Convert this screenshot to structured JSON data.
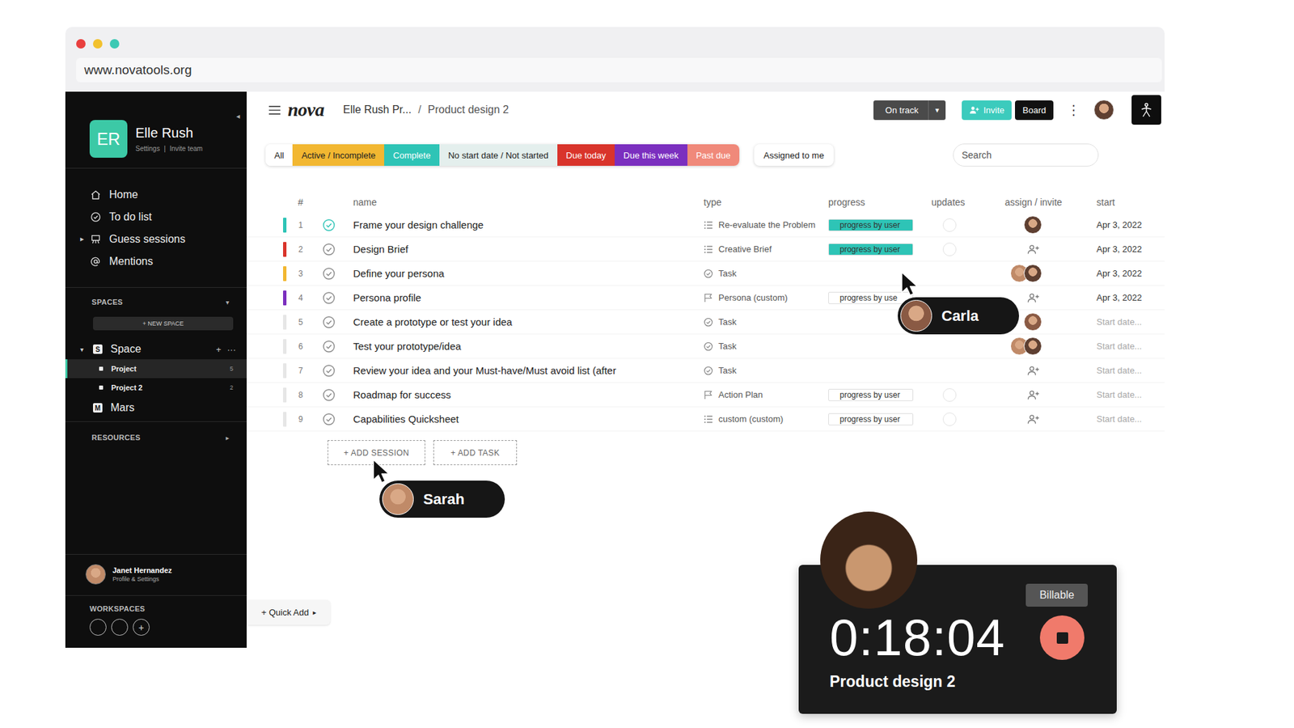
{
  "browser": {
    "url": "www.novatools.org"
  },
  "sidebar": {
    "collapse": "◂",
    "user": {
      "initials": "ER",
      "name": "Elle Rush",
      "links": [
        "Settings",
        "Invite team"
      ],
      "separator": "|"
    },
    "nav": [
      {
        "label": "Home",
        "kind": "home"
      },
      {
        "label": "To do list",
        "kind": "todo"
      },
      {
        "label": "Guess sessions",
        "kind": "sessions",
        "expander": "▸"
      },
      {
        "label": "Mentions",
        "kind": "mentions"
      }
    ],
    "spaces": {
      "title": "SPACES",
      "caret": "▾",
      "new_button": "+ NEW SPACE",
      "tree": [
        {
          "label": "Space",
          "badge": "S",
          "caret": "▾",
          "expanded": true,
          "actions": [
            "+",
            "···"
          ],
          "children": [
            {
              "label": "Project",
              "count": "5",
              "selected": true
            },
            {
              "label": "Project 2",
              "count": "2",
              "selected": false
            }
          ]
        },
        {
          "label": "Mars",
          "badge": "M",
          "caret": "",
          "expanded": false,
          "actions": [],
          "children": []
        }
      ]
    },
    "resources": {
      "title": "RESOURCES",
      "caret": "▸"
    },
    "profile": {
      "name": "Janet Hernandez",
      "subtitle": "Profile & Settings"
    },
    "workspaces": {
      "title": "WORKSPACES",
      "items": [
        "",
        "",
        "+"
      ]
    }
  },
  "header": {
    "logo": "nova",
    "breadcrumb": {
      "items": [
        "Elle Rush Pr...",
        "Product design 2"
      ],
      "separator": "/"
    },
    "status": {
      "label": "On track",
      "caret": "▾"
    },
    "invite": "Invite",
    "board": "Board",
    "more": "⋮"
  },
  "filters": [
    {
      "label": "All",
      "color": "#ffffff",
      "selected": false
    },
    {
      "label": "Active / Incomplete",
      "color": "#f2b731",
      "selected": false
    },
    {
      "label": "Complete",
      "color": "#2ec4b6",
      "selected": false
    },
    {
      "label": "No start date / Not started",
      "color": "#e4efed",
      "selected": false
    },
    {
      "label": "Due today",
      "color": "#d9342b",
      "selected": false
    },
    {
      "label": "Due this week",
      "color": "#7b2fbf",
      "selected": false
    },
    {
      "label": "Past due",
      "color": "#f0897a",
      "selected": false
    }
  ],
  "assigned": {
    "label": "Assigned to me",
    "selected": false
  },
  "search": {
    "placeholder": "Search"
  },
  "table": {
    "columns": [
      "#",
      "name",
      "type",
      "progress",
      "updates",
      "assign / invite",
      "start"
    ],
    "rows": [
      {
        "number": "1",
        "name": "Frame your design challenge",
        "color": "#2ec4b6",
        "done": true,
        "type": {
          "kind": "list",
          "label": "Re-evaluate the Problem"
        },
        "progress": {
          "label": "progress by user",
          "level": 1.0
        },
        "updates": true,
        "assignees": 1,
        "start": "Apr 3, 2022",
        "start_set": true
      },
      {
        "number": "2",
        "name": "Design Brief",
        "color": "#d9342b",
        "done": false,
        "type": {
          "kind": "list",
          "label": "Creative Brief"
        },
        "progress": {
          "label": "progress by user",
          "level": 1.0
        },
        "updates": true,
        "assignees": 0,
        "start": "Apr 3, 2022",
        "start_set": true
      },
      {
        "number": "3",
        "name": "Define your persona",
        "color": "#f2b731",
        "done": false,
        "type": {
          "kind": "check",
          "label": "Task"
        },
        "progress": null,
        "updates": false,
        "assignees": 2,
        "start": "Apr 3, 2022",
        "start_set": true
      },
      {
        "number": "4",
        "name": "Persona profile",
        "color": "#7b2fbf",
        "done": false,
        "type": {
          "kind": "flag",
          "label": "Persona (custom)"
        },
        "progress": {
          "label": "progress by use",
          "level": 0.0
        },
        "updates": false,
        "assignees": 0,
        "start": "Apr 3, 2022",
        "start_set": true
      },
      {
        "number": "5",
        "name": "Create a prototype or test your idea",
        "color": "#e6e6e6",
        "done": false,
        "type": {
          "kind": "check",
          "label": "Task"
        },
        "progress": null,
        "updates": false,
        "assignees": 1,
        "start": "Start date...",
        "start_set": false
      },
      {
        "number": "6",
        "name": "Test your prototype/idea",
        "color": "#e6e6e6",
        "done": false,
        "type": {
          "kind": "check",
          "label": "Task"
        },
        "progress": null,
        "updates": false,
        "assignees": 2,
        "start": "Start date...",
        "start_set": false
      },
      {
        "number": "7",
        "name": "Review your idea and your Must-have/Must avoid list (after",
        "color": "#e6e6e6",
        "done": false,
        "type": {
          "kind": "check",
          "label": "Task"
        },
        "progress": null,
        "updates": false,
        "assignees": 0,
        "start": "Start date...",
        "start_set": false
      },
      {
        "number": "8",
        "name": "Roadmap for success",
        "color": "#e6e6e6",
        "done": false,
        "type": {
          "kind": "flag",
          "label": "Action Plan"
        },
        "progress": {
          "label": "progress by user",
          "level": 0.0
        },
        "updates": true,
        "assignees": 0,
        "start": "Start date...",
        "start_set": false
      },
      {
        "number": "9",
        "name": "Capabilities Quicksheet",
        "color": "#e6e6e6",
        "done": false,
        "type": {
          "kind": "list",
          "label": "custom (custom)"
        },
        "progress": {
          "label": "progress by user",
          "level": 0.0
        },
        "updates": true,
        "assignees": 0,
        "start": "Start date...",
        "start_set": false
      }
    ]
  },
  "actions": [
    "+ ADD SESSION",
    "+ ADD TASK"
  ],
  "quick_add": {
    "label": "+ Quick Add",
    "caret": "▸"
  },
  "cursors": [
    {
      "name": "Carla"
    },
    {
      "name": "Sarah"
    }
  ],
  "timer": {
    "time": "0:18:04",
    "project": "Product design 2",
    "badge": "Billable",
    "running": true
  }
}
